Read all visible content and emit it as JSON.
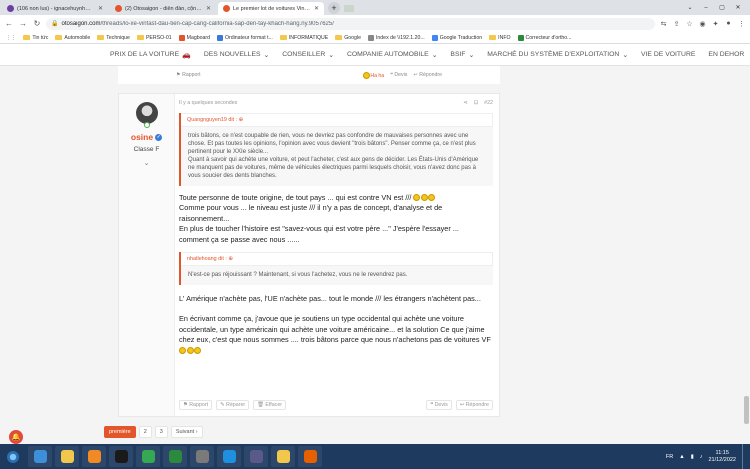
{
  "tabs": [
    {
      "title": "(106 non lus) - ignacehuynh@ya...",
      "color": "#6b3fa0",
      "active": false
    },
    {
      "title": "(2) Otosaigon - diễn đàn, cộng đ...",
      "color": "#e3552a",
      "active": false
    },
    {
      "title": "Le premier lot de voitures VinFa...",
      "color": "#e3552a",
      "active": true
    }
  ],
  "address": {
    "domain": "otosaigon.com",
    "path": "/threads/lo-xe-vinfast-dau-tien-cap-cang-california-sap-den-tay-khach-hang.ny.9057625/"
  },
  "bookmarks": [
    {
      "label": "Tin tức",
      "kind": "folder"
    },
    {
      "label": "Automobile",
      "kind": "folder"
    },
    {
      "label": "Technique",
      "kind": "folder"
    },
    {
      "label": "PERSO-01",
      "kind": "folder"
    },
    {
      "label": "Magboard",
      "kind": "site",
      "color": "#e3552a"
    },
    {
      "label": "Ordinateur format t...",
      "kind": "site",
      "color": "#3b7bd8"
    },
    {
      "label": "INFORMATIQUE",
      "kind": "folder"
    },
    {
      "label": "Google",
      "kind": "folder"
    },
    {
      "label": "Index de \\\\192.1.20...",
      "kind": "site",
      "color": "#888888"
    },
    {
      "label": "Google Traduction",
      "kind": "site",
      "color": "#4285f4"
    },
    {
      "label": "INFO",
      "kind": "folder"
    },
    {
      "label": "Correcteur d'ortho...",
      "kind": "site",
      "color": "#2b8a3e"
    }
  ],
  "sitenav": [
    {
      "label": "PRIX DE LA VOITURE",
      "car": true
    },
    {
      "label": "DES NOUVELLES",
      "chev": true
    },
    {
      "label": "CONSEILLER",
      "chev": true
    },
    {
      "label": "COMPANIE AUTOMOBILE",
      "chev": true
    },
    {
      "label": "BSIF",
      "chev": true
    },
    {
      "label": "MARCHÉ DU SYSTÈME D'EXPLOITATION",
      "chev": true
    },
    {
      "label": "VIE DE VOITURE",
      "chev": false
    },
    {
      "label": "EN DEHOR",
      "chev": false
    }
  ],
  "prev_post": {
    "report": "Rapport",
    "haha": "Ha ha",
    "devis": "Devis",
    "reply": "Répondre"
  },
  "post": {
    "username": "osine",
    "role": "Classe F",
    "time": "Il y a quelques secondes",
    "number": "#22",
    "quote1": {
      "author": "Quangnguyen19 dit :",
      "text": "trois bâtons, ce n'est coupable de rien, vous ne devriez pas confondre de mauvaises personnes avec une chose. Et pas toutes les opinions, l'opinion avec vous devient \"trois bâtons\". Penser comme ça, ce n'est plus pertinent pour le XXIe siècle...\nQuant à savoir qui achète une voiture, et peut l'acheter, c'est aux gens de décider. Les États-Unis d'Amérique ne manquent pas de voitures, même de véhicules électriques parmi lesquels choisir, vous n'avez donc pas à vous soucier des dents blanches."
    },
    "para1": [
      "Toute personne de toute origine, de tout pays ... qui est contre VN est ///",
      "Comme pour vous ... le niveau est juste /// il n'y a pas de concept, d'analyse et de raisonnement...",
      "En plus de toucher l'histoire est \"savez-vous qui est votre père ...\" J'espère l'essayer ...",
      "comment ça se passe avec nous ......"
    ],
    "quote2": {
      "author": "nhatlehoang dit :",
      "text": "N'est-ce pas réjouissant ? Maintenant, si vous l'achetez, vous ne le revendrez pas."
    },
    "para2": "L' Amérique n'achète pas, l'UE n'achète pas... tout le monde /// les étrangers n'achètent pas...",
    "para3": "En écrivant comme ça, j'avoue que je soutiens un type occidental qui achète une voiture occidentale, un type américain qui achète une voiture américaine... et la solution Ce que j'aime chez eux, c'est que nous sommes .... trois bâtons parce que nous n'achetons pas de voitures VF",
    "footer": {
      "report": "Rapport",
      "reply": "Réparer",
      "delete": "Effacer",
      "devis": "Devis",
      "respond": "Répondre"
    }
  },
  "pager": {
    "first": "première",
    "p2": "2",
    "p3": "3",
    "next": "Suivant ›"
  },
  "taskbar": {
    "icons": [
      {
        "name": "ie-icon",
        "color": "#3c8fd8"
      },
      {
        "name": "file-explorer-icon",
        "color": "#f1c84b"
      },
      {
        "name": "media-player-icon",
        "color": "#f08a24"
      },
      {
        "name": "eye-app-icon",
        "color": "#1a1a1a"
      },
      {
        "name": "chrome-icon",
        "color": "#34a853"
      },
      {
        "name": "spreadsheet-icon",
        "color": "#2b8a3e"
      },
      {
        "name": "settings-app-icon",
        "color": "#7a7a7a"
      },
      {
        "name": "edge-icon",
        "color": "#1f8fe0"
      },
      {
        "name": "device-manager-icon",
        "color": "#5a5a8a"
      },
      {
        "name": "folder-icon",
        "color": "#f1c84b"
      },
      {
        "name": "firefox-icon",
        "color": "#e66000"
      }
    ],
    "lang": "FR",
    "time": "11:15",
    "date": "21/12/2022"
  }
}
